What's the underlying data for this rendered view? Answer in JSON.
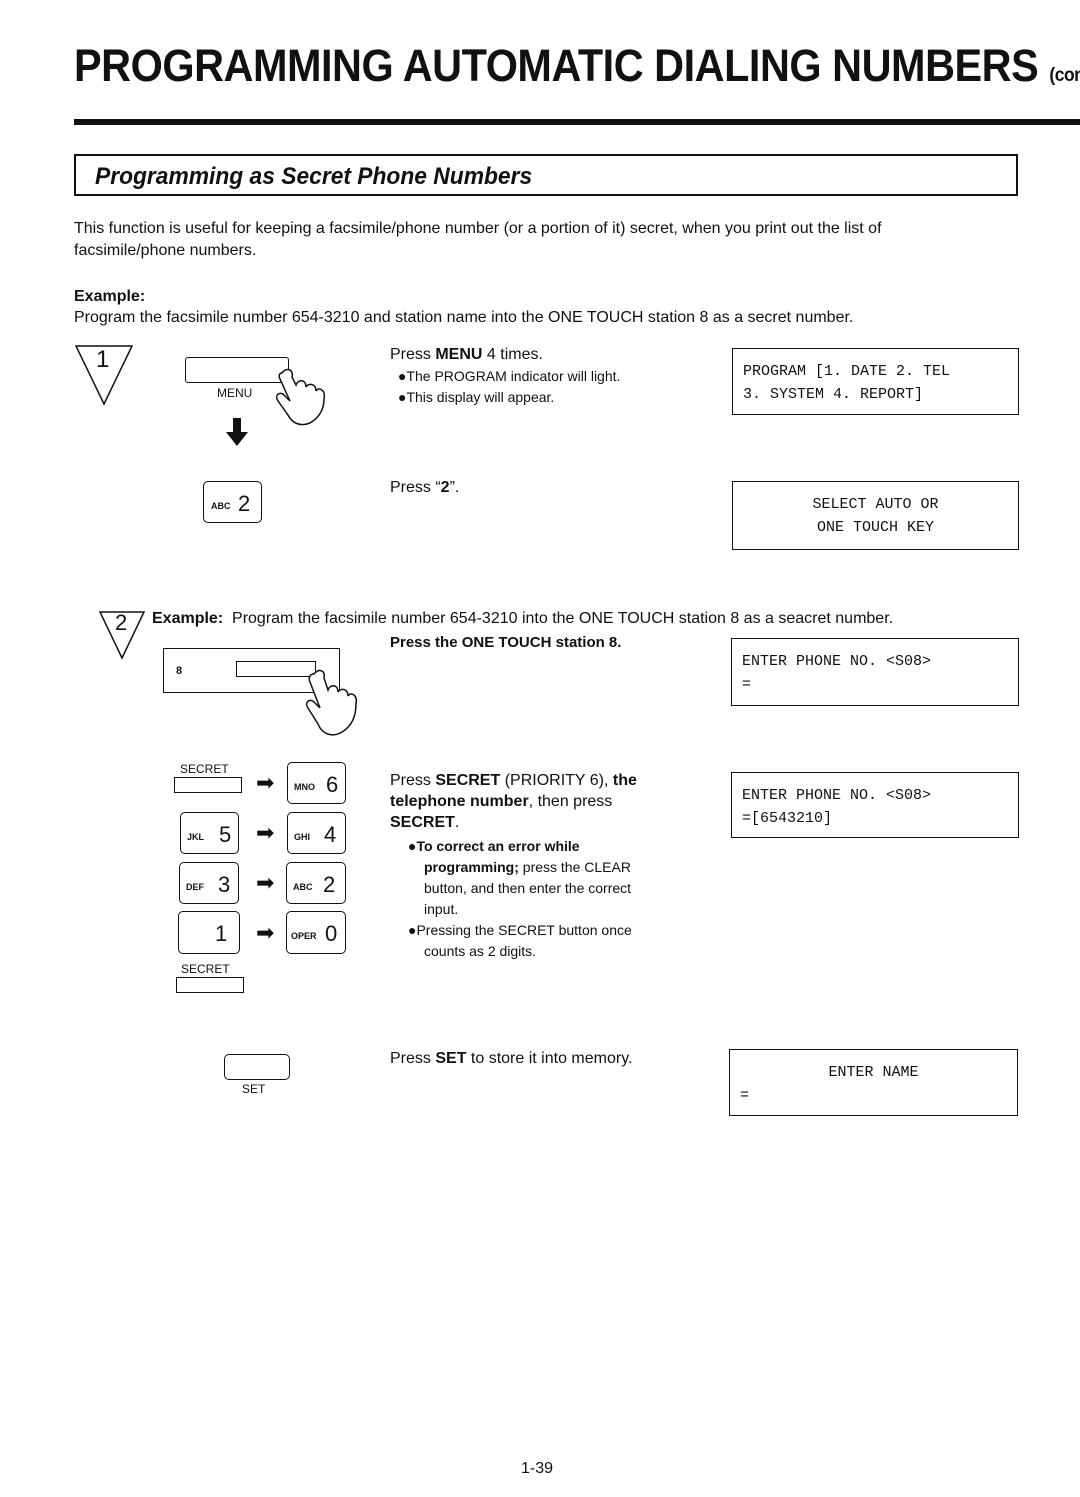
{
  "header": {
    "title": "PROGRAMMING AUTOMATIC DIALING NUMBERS",
    "title_suffix": "(cont.)"
  },
  "section": {
    "title": "Programming as Secret Phone Numbers",
    "intro_line1": "This function is useful for keeping a facsimile/phone number (or a portion of it) secret, when you print out the list of",
    "intro_line2": "facsimile/phone numbers.",
    "example_label": "Example:",
    "example_text": "Program the facsimile number 654-3210 and station name into the ONE TOUCH station 8 as a secret number."
  },
  "step1": {
    "number": "1",
    "menu_key_label": "MENU",
    "instr_a_pre": "Press ",
    "instr_a_bold": "MENU",
    "instr_a_post": " 4 times.",
    "bullet1": "●The PROGRAM indicator will light.",
    "bullet2": "●This display will appear.",
    "display1_line1": "PROGRAM [1. DATE 2. TEL",
    "display1_line2": "3. SYSTEM 4. REPORT]",
    "key2_sub": "ABC",
    "key2_num": "2",
    "instr_b_pre": "Press “",
    "instr_b_bold": "2",
    "instr_b_post": "”.",
    "display2_line1": "SELECT AUTO OR",
    "display2_line2": "ONE TOUCH KEY"
  },
  "step2": {
    "number": "2",
    "example_label": "Example:",
    "example_text": "Program the facsimile number 654-3210 into the ONE TOUCH station 8 as a seacret number.",
    "one_touch_label": "8",
    "instr_press_one_touch": "Press the ONE TOUCH station 8.",
    "display3_line1": "ENTER PHONE NO. <S08>",
    "display3_line2": "=",
    "secret_label": "SECRET",
    "keys": [
      {
        "sub": "MNO",
        "num": "6"
      },
      {
        "sub": "JKL",
        "num": "5"
      },
      {
        "sub": "GHI",
        "num": "4"
      },
      {
        "sub": "DEF",
        "num": "3"
      },
      {
        "sub": "ABC",
        "num": "2"
      },
      {
        "sub": "",
        "num": "1"
      },
      {
        "sub": "OPER",
        "num": "0"
      }
    ],
    "instr_secret_1a": "Press ",
    "instr_secret_1b": "SECRET",
    "instr_secret_1c": " (PRIORITY 6), ",
    "instr_secret_1d": "the",
    "instr_secret_2a": "telephone number",
    "instr_secret_2b": ", then press",
    "instr_secret_3a": "SECRET",
    "instr_secret_3b": ".",
    "note1_bold_1": "●To correct an error while",
    "note1_bold_2": "programming;",
    "note1_rest_2": " press the CLEAR",
    "note1_line3": "button, and then enter the correct",
    "note1_line4": "input.",
    "note2_line1": "●Pressing the SECRET button once",
    "note2_line2": "counts as 2 digits.",
    "display4_line1": "ENTER PHONE NO. <S08>",
    "display4_line2": "=[6543210]",
    "set_label": "SET",
    "instr_set_pre": "Press ",
    "instr_set_bold": "SET",
    "instr_set_post": " to store it into memory.",
    "display5_line1": "ENTER NAME",
    "display5_line2": "="
  },
  "footer": {
    "page_number": "1-39"
  }
}
